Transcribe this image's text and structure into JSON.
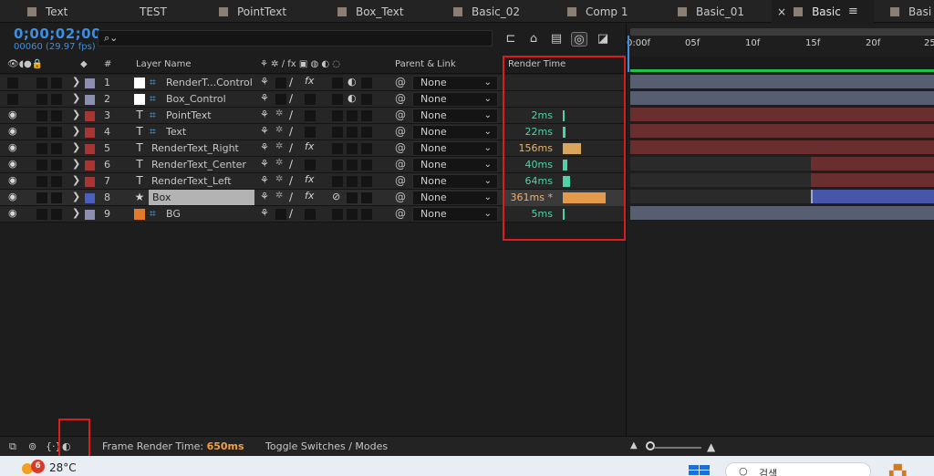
{
  "tabs": [
    {
      "label": "Text",
      "color": "#8a7f72"
    },
    {
      "label": "TEST",
      "color": "#8a7f72"
    },
    {
      "label": "PointText",
      "color": "#8a7f72"
    },
    {
      "label": "Box_Text",
      "color": "#8a7f72"
    },
    {
      "label": "Basic_02",
      "color": "#8a7f72"
    },
    {
      "label": "Comp 1",
      "color": "#8a7f72"
    },
    {
      "label": "Basic_01",
      "color": "#8a7f72"
    },
    {
      "label": "Basic",
      "color": "#8a7f72",
      "active": true
    },
    {
      "label": "Basi",
      "color": "#8a7f72"
    }
  ],
  "header": {
    "timecode": "0;00;02;00",
    "frame_fps": "00060 (29.97 fps)",
    "search_placeholder": ""
  },
  "columns": {
    "hash": "#",
    "layer_name": "Layer Name",
    "parent_link": "Parent & Link",
    "render_time": "Render Time"
  },
  "layers": [
    {
      "num": "1",
      "name": "RenderT...Control",
      "type": "solid",
      "label_color": "#8b8fb0",
      "eye": false,
      "fx": true,
      "parent": "None",
      "render_time": "",
      "bar": 0
    },
    {
      "num": "2",
      "name": "Box_Control",
      "type": "solid",
      "label_color": "#8b8fb0",
      "eye": false,
      "fx": false,
      "parent": "None",
      "render_time": "",
      "bar": 0
    },
    {
      "num": "3",
      "name": "PointText",
      "type": "text",
      "label_color": "#a83434",
      "eye": true,
      "fx": false,
      "parent": "None",
      "render_time": "2ms",
      "bar": 2
    },
    {
      "num": "4",
      "name": "Text",
      "type": "text",
      "label_color": "#a83434",
      "eye": true,
      "fx": false,
      "parent": "None",
      "render_time": "22ms",
      "bar": 22
    },
    {
      "num": "5",
      "name": "RenderText_Right",
      "type": "text",
      "label_color": "#a83434",
      "eye": true,
      "fx": true,
      "parent": "None",
      "render_time": "156ms",
      "bar": 156
    },
    {
      "num": "6",
      "name": "RenderText_Center",
      "type": "text",
      "label_color": "#a83434",
      "eye": true,
      "fx": false,
      "parent": "None",
      "render_time": "40ms",
      "bar": 40
    },
    {
      "num": "7",
      "name": "RenderText_Left",
      "type": "text",
      "label_color": "#a83434",
      "eye": true,
      "fx": true,
      "parent": "None",
      "render_time": "64ms",
      "bar": 64
    },
    {
      "num": "8",
      "name": "Box",
      "type": "shape",
      "label_color": "#4b5fc0",
      "eye": true,
      "fx": true,
      "parent": "None",
      "render_time": "361ms *",
      "bar": 361
    },
    {
      "num": "9",
      "name": "BG",
      "type": "solid-img",
      "label_color": "#8b8fb0",
      "eye": true,
      "fx": false,
      "parent": "None",
      "render_time": "5ms",
      "bar": 5
    }
  ],
  "ruler_ticks": [
    "0:00f",
    "05f",
    "10f",
    "15f",
    "20f",
    "25"
  ],
  "status": {
    "frame_render_label": "Frame Render Time:",
    "frame_render_value": "650ms",
    "toggle_label": "Toggle Switches / Modes"
  },
  "taskbar": {
    "badge": "6",
    "temperature": "28°C",
    "search_text": "검색"
  },
  "colors": {
    "accent_blue": "#3d8ee0",
    "render_green": "#4fd2a8",
    "render_orange": "#e39a4b",
    "highlight_red": "#e01b1b"
  }
}
